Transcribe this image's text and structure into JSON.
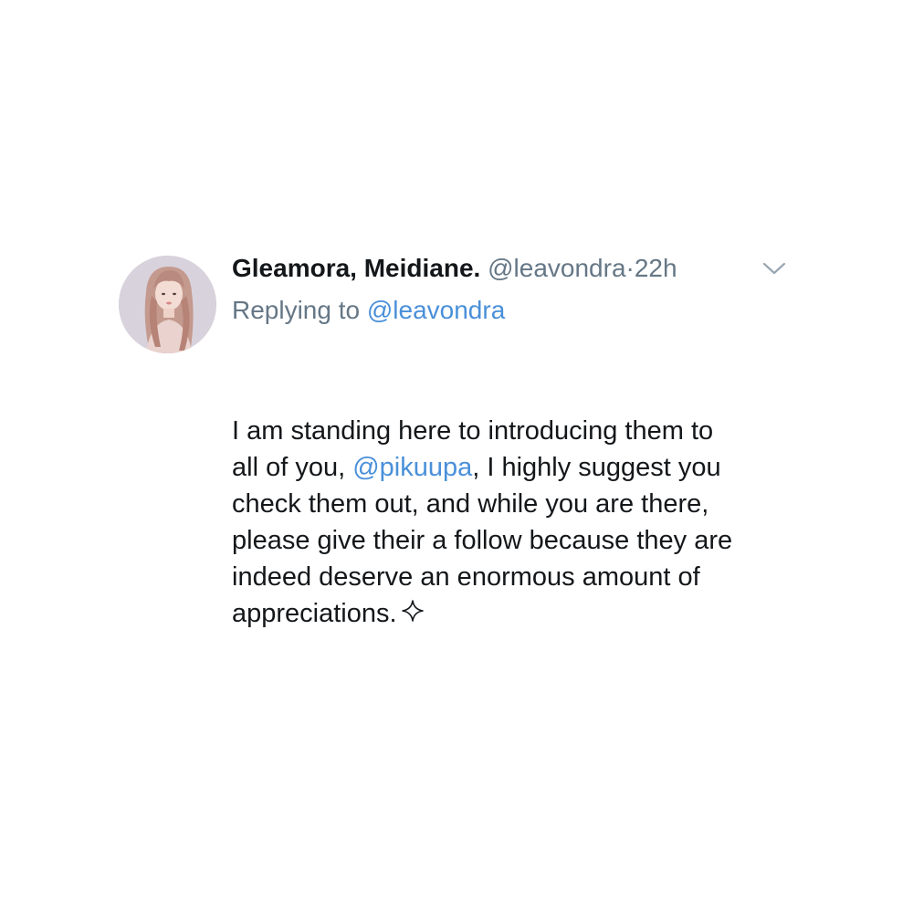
{
  "tweet": {
    "author": {
      "display_name": "Gleamora, Meidiane.",
      "handle": "@leavondra",
      "separator": "·",
      "time": "22h"
    },
    "reply": {
      "prefix": "Replying to",
      "mention": "@leavondra"
    },
    "body": {
      "line1": "I am standing here to introducing them to",
      "line2_pre": "all of you,",
      "line2_mention": "@pikuupa",
      "line2_post": ", I highly suggest you",
      "line3": "check them out, and while you are there,",
      "line4": "please give their a follow because they are",
      "line5": "indeed deserve an enormous amount of",
      "line6": "appreciations."
    },
    "icons": {
      "menu": "chevron-down-icon",
      "sparkle": "sparkle-icon",
      "avatar": "avatar"
    },
    "colors": {
      "text": "#14171a",
      "secondary": "#657786",
      "link": "#4a90d9",
      "background": "#ffffff"
    }
  }
}
